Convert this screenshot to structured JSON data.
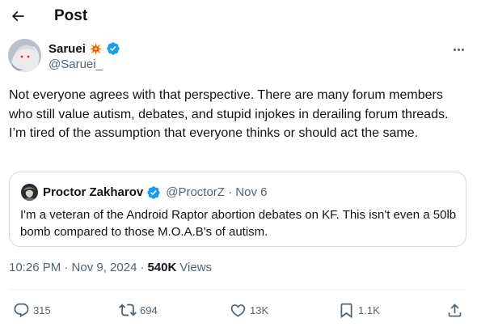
{
  "header": {
    "title": "Post"
  },
  "post": {
    "author_name": "Saruei",
    "author_handle": "@Saruei_",
    "text": "Not everyone agrees with that perspective. There are many forum members who still value autism, debates, and stupid injokes in derailing forum threads. I’m tired of the assumption that everyone thinks or should act the same.",
    "timestamp": "10:26 PM · Nov 9, 2024",
    "separator": "·",
    "views_count": "540K",
    "views_label": "Views"
  },
  "quote": {
    "author_name": "Proctor Zakharov",
    "meta": "@ProctorZ · Nov 6",
    "text": "I'm a veteran of the Android Raptor abortion debates on KF. This isn't even a 50lb bomb compared to those M.O.A.B's of autism."
  },
  "actions": {
    "replies": "315",
    "reposts": "694",
    "likes": "13K",
    "bookmarks": "1.1K"
  },
  "colors": {
    "text": "#0f1419",
    "secondary": "#536471",
    "verified": "#1d9bf0",
    "border": "#cfd9de"
  },
  "icons": [
    "back-arrow-icon",
    "collision-emoji-icon",
    "verified-badge-icon",
    "more-icon",
    "reply-icon",
    "repost-icon",
    "like-icon",
    "bookmark-icon",
    "share-icon"
  ]
}
